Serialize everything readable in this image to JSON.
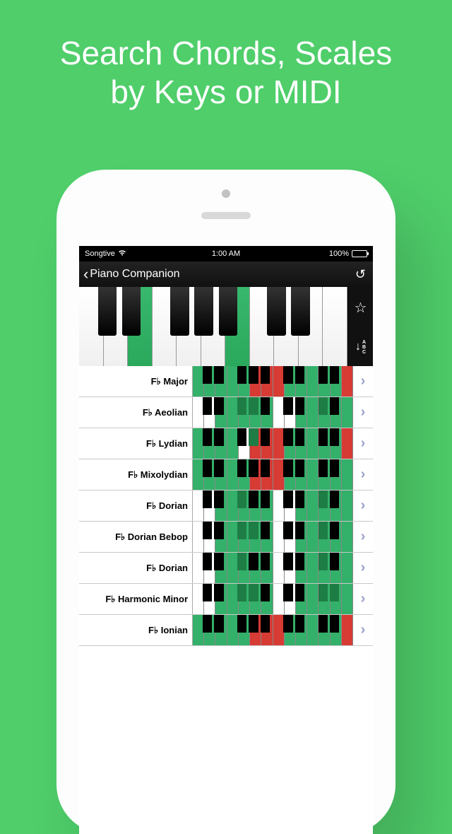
{
  "promo": {
    "line1": "Search Chords, Scales",
    "line2": "by Keys or MIDI"
  },
  "status": {
    "carrier": "Songtive",
    "time": "1:00 AM",
    "battery": "100%"
  },
  "nav": {
    "backLabel": "Piano Companion",
    "refreshGlyph": "↺"
  },
  "sideTools": {
    "starGlyph": "☆",
    "sortArrow": "↓",
    "sortA": "A",
    "sortB": "B",
    "sortC": "C"
  },
  "bigKeyboard": {
    "whiteCount": 11,
    "selectedWhite": [
      2,
      6
    ],
    "blackPositions": [
      7,
      16,
      34,
      43,
      52,
      70,
      79
    ]
  },
  "miniBlackPositions": [
    6,
    13.2,
    27.7,
    35,
    42.2,
    56.5,
    63.7,
    78.2,
    85.4
  ],
  "rows": [
    {
      "label": "F♭ Major",
      "green": [
        0,
        1,
        2,
        3,
        4,
        8,
        9,
        10,
        11,
        12
      ],
      "red": [
        5,
        6,
        7,
        13
      ],
      "gblack": []
    },
    {
      "label": "F♭ Aeolian",
      "green": [
        2,
        3,
        4,
        5,
        6,
        9,
        10,
        11,
        12,
        13
      ],
      "red": [],
      "gblack": [
        2,
        3,
        7
      ]
    },
    {
      "label": "F♭ Lydian",
      "green": [
        0,
        1,
        2,
        3,
        8,
        9,
        10,
        11,
        12
      ],
      "red": [
        5,
        6,
        7,
        13
      ],
      "gblack": [
        3
      ]
    },
    {
      "label": "F♭ Mixolydian",
      "green": [
        0,
        1,
        2,
        3,
        4,
        8,
        9,
        10,
        11,
        12,
        13
      ],
      "red": [
        5,
        6,
        7
      ],
      "gblack": []
    },
    {
      "label": "F♭ Dorian",
      "green": [
        2,
        3,
        4,
        5,
        6,
        9,
        10,
        11,
        12,
        13
      ],
      "red": [],
      "gblack": [
        2,
        7
      ]
    },
    {
      "label": "F♭ Dorian Bebop",
      "green": [
        2,
        3,
        4,
        5,
        6,
        9,
        10,
        11,
        12,
        13
      ],
      "red": [],
      "gblack": [
        2,
        3,
        7
      ]
    },
    {
      "label": "F♭ Dorian",
      "green": [
        2,
        3,
        4,
        5,
        6,
        9,
        10,
        11,
        12,
        13
      ],
      "red": [],
      "gblack": [
        2,
        7
      ]
    },
    {
      "label": "F♭ Harmonic Minor",
      "green": [
        2,
        3,
        4,
        5,
        6,
        9,
        10,
        11,
        12,
        13
      ],
      "red": [],
      "gblack": [
        2,
        3,
        7,
        8
      ]
    },
    {
      "label": "F♭ Ionian",
      "green": [
        0,
        1,
        2,
        3,
        4,
        8,
        9,
        10,
        11,
        12
      ],
      "red": [
        5,
        6,
        7,
        13
      ],
      "gblack": []
    }
  ],
  "disclosureGlyph": "›"
}
